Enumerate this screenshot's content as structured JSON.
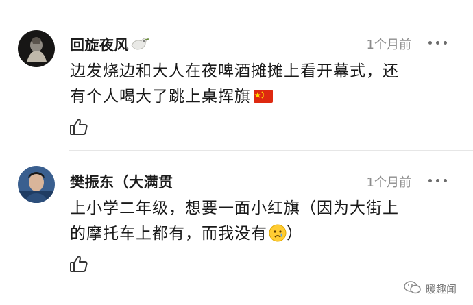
{
  "comments": [
    {
      "username": "回旋夜风",
      "username_emoji": "🕊",
      "time": "1个月前",
      "text_line1": "边发烧边和大人在夜啤酒摊摊上看开幕式，还",
      "text_line2": "有个人喝大了跳上桌挥旗",
      "trailing_icon": "china-flag-icon"
    },
    {
      "username": "樊振东（大满贯",
      "time": "1个月前",
      "text_line1": "上小学二年级，想要一面小红旗（因为大街上",
      "text_line2": "的摩托车上都有，而我没有",
      "text_line2_suffix": "）",
      "trailing_icon": "crying-face-icon"
    }
  ],
  "watermark": {
    "text": "暖趣闻",
    "icon": "wechat-icon"
  },
  "colors": {
    "name": "#1b1b1b",
    "time": "#8c8c8c",
    "divider": "#e6e6e6",
    "flag_red": "#de2910",
    "flag_star": "#ffde00"
  }
}
